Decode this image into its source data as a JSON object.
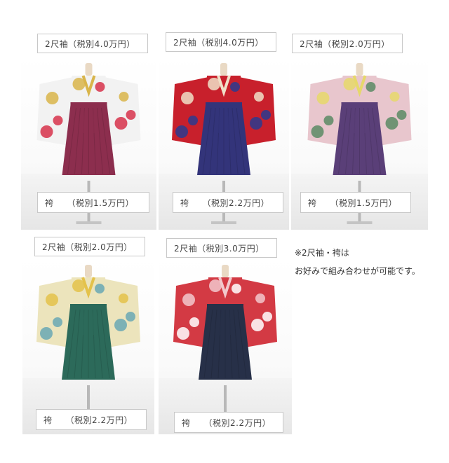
{
  "items": [
    {
      "sleeve": "2尺袖（税別4.0万円）",
      "hakama": "袴　　（税別1.5万円）",
      "colors": {
        "kimono": "#f2f2f2",
        "pattern": "#d7324b",
        "accent": "#d9b54a",
        "hakama": "#8c2e4e"
      }
    },
    {
      "sleeve": "2尺袖（税別4.0万円）",
      "hakama": "袴　　（税別2.2万円）",
      "colors": {
        "kimono": "#c8202c",
        "pattern": "#2c3b8f",
        "accent": "#f0e0c8",
        "hakama": "#33347a"
      }
    },
    {
      "sleeve": "2尺袖（税別2.0万円）",
      "hakama": "袴　　（税別1.5万円）",
      "colors": {
        "kimono": "#e8c6cd",
        "pattern": "#5a8a64",
        "accent": "#e6d86a",
        "hakama": "#5a3f78"
      }
    },
    {
      "sleeve": "2尺袖（税別2.0万円）",
      "hakama": "袴　　（税別2.2万円）",
      "colors": {
        "kimono": "#ece4bc",
        "pattern": "#6aa8b4",
        "accent": "#e4c24a",
        "hakama": "#2c6a5a"
      }
    },
    {
      "sleeve": "2尺袖（税別3.0万円）",
      "hakama": "袴　　（税別2.2万円）",
      "colors": {
        "kimono": "#d33a44",
        "pattern": "#ffffff",
        "accent": "#f2c8cc",
        "hakama": "#273048"
      }
    }
  ],
  "note": {
    "line1": "※2尺袖・袴は",
    "line2": "お好みで組み合わせが可能です。"
  }
}
